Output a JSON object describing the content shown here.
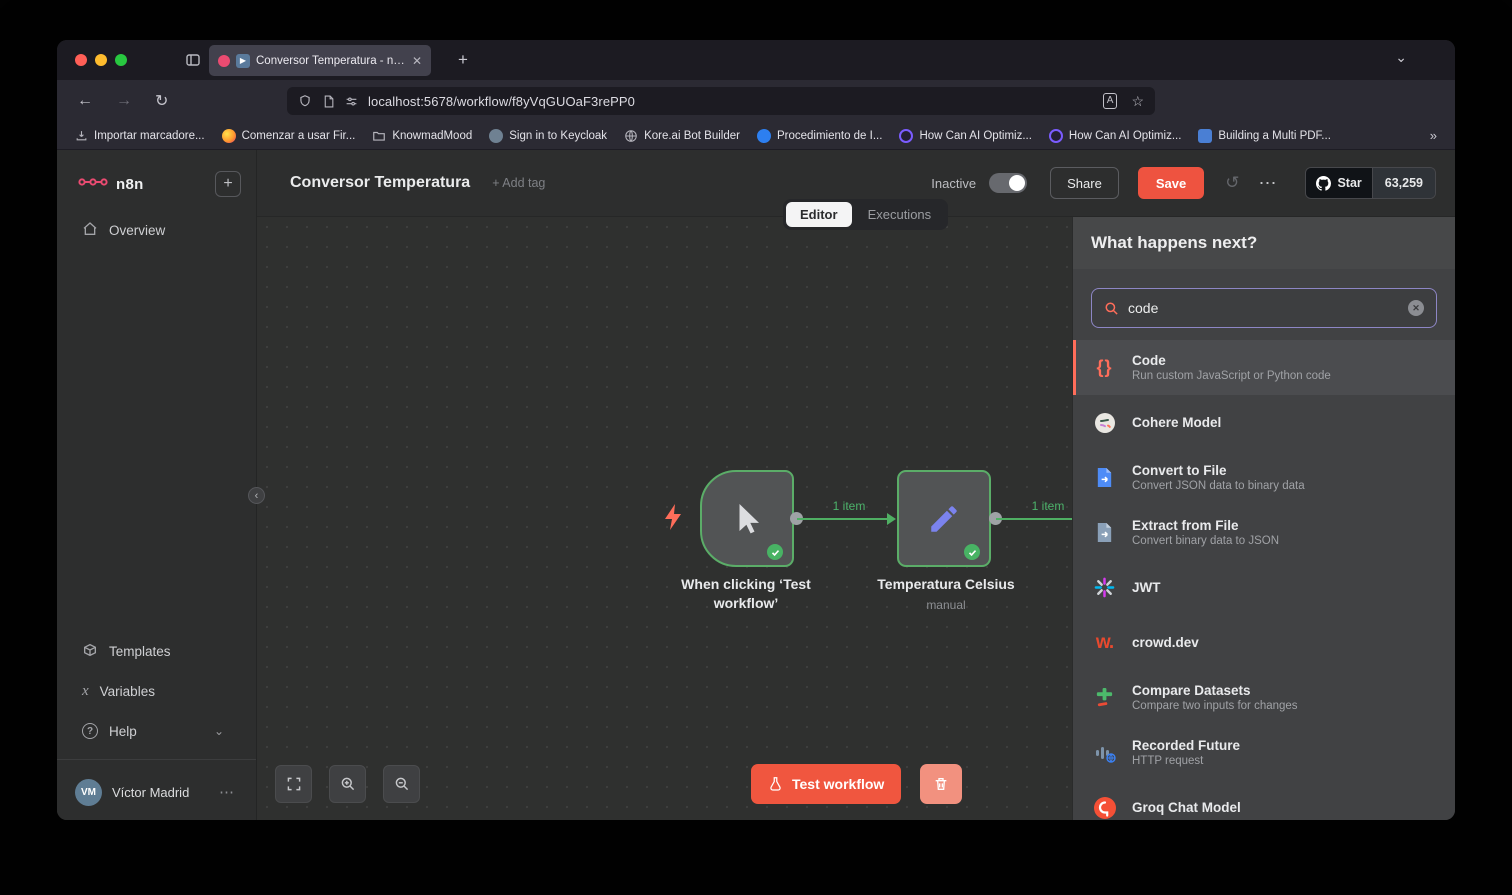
{
  "icons": {
    "close": "✕",
    "plus": "+",
    "chevron_down": "⌄",
    "chevron_left": "‹",
    "back": "←",
    "forward": "→",
    "reload": "↻",
    "history": "↺",
    "star_outline": "☆",
    "menu": "☰",
    "ellipsis": "⋯",
    "overflow": "»",
    "play": "▶",
    "translate": "A",
    "code_braces": "{}",
    "variables_x": "x",
    "help_question": "?",
    "crowd_w": "w."
  },
  "browser": {
    "tab_title": "Conversor Temperatura - n8...",
    "url": "localhost:5678/workflow/f8yVqGUOaF3rePP0",
    "bookmarks": [
      {
        "label": "Importar marcadore..."
      },
      {
        "label": "Comenzar a usar Fir..."
      },
      {
        "label": "KnowmadMood"
      },
      {
        "label": "Sign in to Keycloak"
      },
      {
        "label": "Kore.ai Bot Builder"
      },
      {
        "label": "Procedimiento de I..."
      },
      {
        "label": "How Can AI Optimiz..."
      },
      {
        "label": "How Can AI Optimiz..."
      },
      {
        "label": "Building a Multi PDF..."
      }
    ]
  },
  "sidebar": {
    "logo": "n8n",
    "overview": "Overview",
    "templates": "Templates",
    "variables": "Variables",
    "help": "Help",
    "user": {
      "name": "Víctor Madrid",
      "initials": "VM"
    }
  },
  "header": {
    "title": "Conversor Temperatura",
    "add_tag": "+ Add tag",
    "inactive": "Inactive",
    "share": "Share",
    "save": "Save",
    "github": {
      "star": "Star",
      "count": "63,259"
    }
  },
  "view_tabs": {
    "editor": "Editor",
    "executions": "Executions"
  },
  "canvas": {
    "trigger_node": {
      "label": "When clicking ‘Test workflow’"
    },
    "set_node": {
      "label": "Temperatura Celsius",
      "subtitle": "manual"
    },
    "edge1_label": "1 item",
    "edge2_label": "1 item",
    "test_button": "Test workflow"
  },
  "panel": {
    "title": "What happens next?",
    "search_value": "code",
    "items": [
      {
        "title": "Code",
        "subtitle": "Run custom JavaScript or Python code"
      },
      {
        "title": "Cohere Model"
      },
      {
        "title": "Convert to File",
        "subtitle": "Convert JSON data to binary data"
      },
      {
        "title": "Extract from File",
        "subtitle": "Convert binary data to JSON"
      },
      {
        "title": "JWT"
      },
      {
        "title": "crowd.dev"
      },
      {
        "title": "Compare Datasets",
        "subtitle": "Compare two inputs for changes"
      },
      {
        "title": "Recorded Future",
        "subtitle": "HTTP request"
      },
      {
        "title": "Groq Chat Model"
      }
    ]
  },
  "colors": {
    "accent": "#ff6d5a",
    "save_button": "#ee5340",
    "success_green": "#4cb05e",
    "search_focus_border": "#8d86c5"
  }
}
